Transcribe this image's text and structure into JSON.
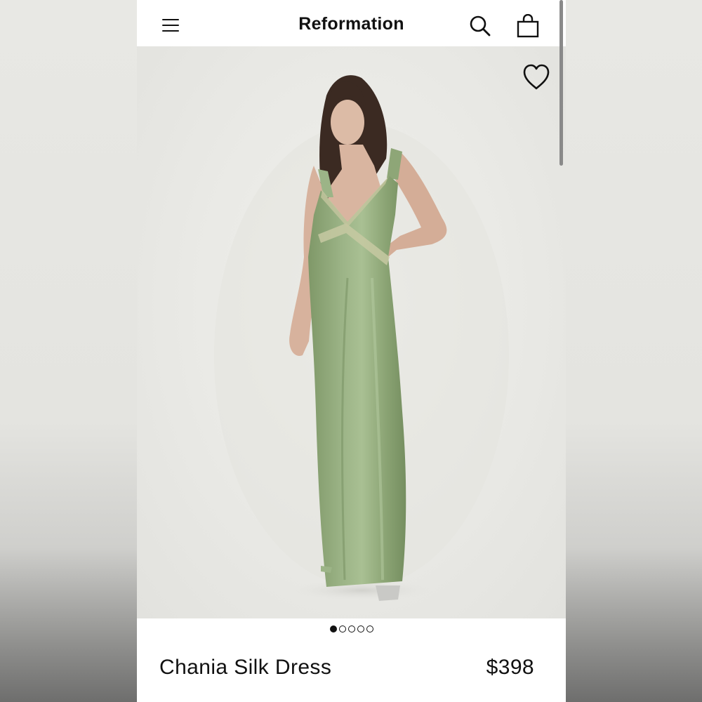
{
  "header": {
    "brand": "Reformation",
    "menu_icon": "hamburger-menu-icon",
    "search_icon": "search-icon",
    "bag_icon": "shopping-bag-icon"
  },
  "gallery": {
    "favorite_icon": "heart-outline-icon",
    "image_count": 5,
    "active_index": 0,
    "image_alt": "Model wearing a sage green silk slip dress"
  },
  "product": {
    "name": "Chania Silk Dress",
    "price": "$398"
  },
  "colors": {
    "dress": "#8fa878",
    "background": "#e9e9e5",
    "text": "#111111"
  }
}
